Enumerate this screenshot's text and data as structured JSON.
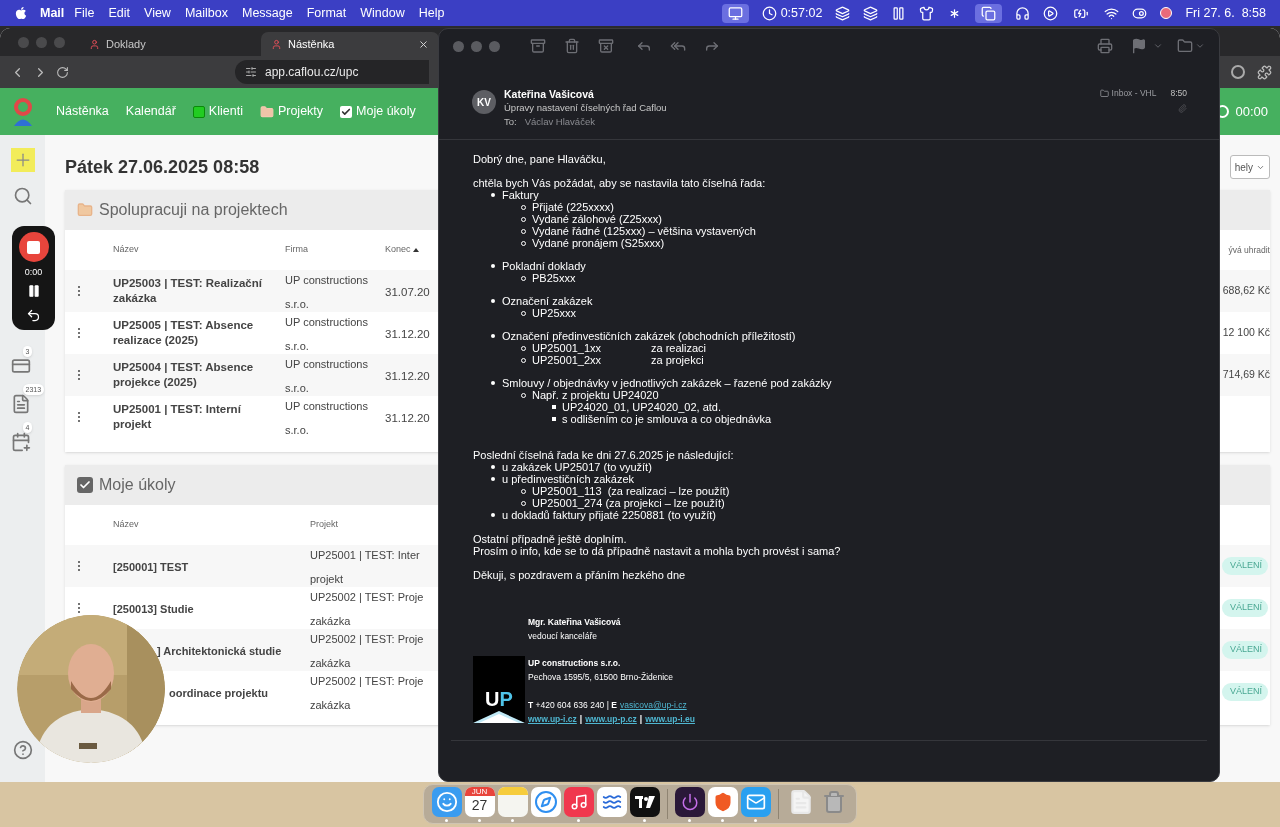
{
  "menu_bar": {
    "app_name": "Mail",
    "menus": [
      "File",
      "Edit",
      "View",
      "Mailbox",
      "Message",
      "Format",
      "Window",
      "Help"
    ],
    "timer": "0:57:02",
    "clock": "Fri 27. 6.  8:58"
  },
  "browser": {
    "tabs": [
      {
        "label": "Doklady",
        "selected": false
      },
      {
        "label": "Nástěnka",
        "selected": true
      }
    ],
    "url": "app.caflou.cz/upc"
  },
  "nav": {
    "items": [
      {
        "label": "Nástěnka",
        "kind": "text"
      },
      {
        "label": "Kalendář",
        "kind": "text"
      },
      {
        "label": "Klienti",
        "kind": "square"
      },
      {
        "label": "Projekty",
        "kind": "folder"
      },
      {
        "label": "Moje úkoly",
        "kind": "check"
      }
    ],
    "timer": "00:00"
  },
  "sidebar": {
    "badges": [
      "3",
      "2313",
      "4"
    ]
  },
  "recorder": {
    "time": "0:00"
  },
  "page_title": "Pátek 27.06.2025 08:58",
  "filter_dropdown": "hely",
  "projects_card": {
    "title": "Spolupracuji na projektech",
    "columns": [
      {
        "label": "Název",
        "sorted": false
      },
      {
        "label": "Firma",
        "sorted": false
      },
      {
        "label": "Konec",
        "sorted": true
      }
    ],
    "right_column": "ývá uhradit",
    "rows": [
      {
        "name": "UP25003 | TEST: Realizační zakázka",
        "company": "UP constructions\ns.r.o.",
        "end": "31.07.20",
        "amount": "688,62 Kč"
      },
      {
        "name": "UP25005 | TEST: Absence realizace (2025)",
        "company": "UP constructions\ns.r.o.",
        "end": "31.12.20",
        "amount": "12 100 Kč"
      },
      {
        "name": "UP25004 | TEST: Absence projekce (2025)",
        "company": "UP constructions\ns.r.o.",
        "end": "31.12.20",
        "amount": "714,69 Kč"
      },
      {
        "name": "UP25001 | TEST: Interní projekt",
        "company": "UP constructions\ns.r.o.",
        "end": "31.12.20"
      }
    ]
  },
  "tasks_card": {
    "title": "Moje úkoly",
    "columns": [
      "Název",
      "Projekt"
    ],
    "rows": [
      {
        "name": "[250001] TEST",
        "project": "UP25001 | TEST: Inter\nprojekt",
        "status": "VÁLENÍ"
      },
      {
        "name": "[250013] Studie",
        "project": "UP25002 | TEST: Proje\nzakázka",
        "status": "VÁLENÍ"
      },
      {
        "name": "] Architektonická studie",
        "project": "UP25002 | TEST: Proje\nzakázka",
        "status": "VÁLENÍ"
      },
      {
        "name": "oordinace projektu",
        "project": "UP25002 | TEST: Proje\nzakázka",
        "status": "VÁLENÍ"
      }
    ]
  },
  "mail": {
    "initials": "KV",
    "sender": "Kateřina Vašicová",
    "subject": "Úpravy nastavení číselných řad Caflou",
    "to_label": "To:",
    "to": "Václav Hlaváček",
    "mailbox": "Inbox - VHL",
    "time": "8:50",
    "greeting": "Dobrý dne, pane Hlaváčku,",
    "request": {
      "intro": "chtěla bych Vás požádat, aby se nastavila tato číselná řada:",
      "items": [
        {
          "text": "Faktury",
          "children": [
            {
              "text": "Přijaté (225xxxx)"
            },
            {
              "text": "Vydané zálohové (Z25xxx)"
            },
            {
              "text": "Vydané řádné (125xxx) – většina vystavených"
            },
            {
              "text": "Vydané pronájem (S25xxx)"
            }
          ]
        },
        {
          "text": "Pokladní doklady",
          "children": [
            {
              "text": "PB25xxx"
            }
          ]
        },
        {
          "text": "Označení zakázek",
          "children": [
            {
              "text": "UP25xxx"
            }
          ]
        },
        {
          "text": "Označení předinvestičních zakázek (obchodních příležitostí)",
          "children": [
            {
              "text": "UP25001_1xx",
              "note": "za realizaci"
            },
            {
              "text": "UP25001_2xx",
              "note": "za projekci"
            }
          ]
        },
        {
          "text": "Smlouvy / objednávky v jednotlivých zakázek – řazené pod zakázky",
          "children": [
            {
              "text": "Např. z projektu UP24020",
              "children": [
                {
                  "text": "UP24020_01, UP24020_02, atd."
                },
                {
                  "text": "s odlišením co je smlouva a co objednávka"
                }
              ]
            }
          ]
        }
      ]
    },
    "status": {
      "intro": "Poslední číselná řada ke dni 27.6.2025 je následující:",
      "items": [
        {
          "text": "u zakázek UP25017 (to využít)"
        },
        {
          "text": "u předinvestičních zakázek",
          "children": [
            {
              "text": "UP25001_113  (za realizaci – lze použít)"
            },
            {
              "text": "UP25001_274 (za projekci – lze použít)"
            }
          ]
        },
        {
          "text": "u dokladů faktury přijaté 2250881 (to využít)"
        }
      ]
    },
    "closing": [
      "Ostatní případně ještě doplním.",
      "Prosím o info, kde se to dá případně nastavit a mohla bych provést i sama?"
    ],
    "thanks": "Děkuji, s pozdravem a přáním hezkého dne",
    "signature": {
      "name": "Mgr. Kateřina Vašicová",
      "role": "vedoucí kanceláře",
      "logo": [
        "U",
        "P"
      ],
      "company": "UP constructions s.r.o.",
      "address": "Pechova 1595/5, 61500 Brno-Židenice",
      "contact": "**T** +420 604 636 240 | **E**",
      "email": "vasicova@up-i.cz",
      "web": [
        {
          "kind": "link",
          "text": "www.up-i.cz"
        },
        {
          "kind": "separator",
          "text": "|"
        },
        {
          "kind": "link",
          "text": "www.up-p.cz"
        },
        {
          "kind": "separator",
          "text": "|"
        },
        {
          "kind": "link",
          "text": "www.up-i.eu"
        }
      ]
    }
  },
  "dock": [
    {
      "kind": "finder",
      "running": true
    },
    {
      "kind": "calendar",
      "month": "JUN",
      "day": "27",
      "running": true
    },
    {
      "kind": "notes",
      "running": true
    },
    {
      "kind": "safari",
      "running": false
    },
    {
      "kind": "music",
      "running": true
    },
    {
      "kind": "freeform",
      "running": false
    },
    {
      "kind": "chart",
      "running": true
    },
    {
      "kind": "divider"
    },
    {
      "kind": "power",
      "running": true
    },
    {
      "kind": "brave",
      "running": true
    },
    {
      "kind": "mail",
      "running": true
    },
    {
      "kind": "divider"
    },
    {
      "kind": "document",
      "running": false
    },
    {
      "kind": "trash",
      "running": false
    }
  ]
}
